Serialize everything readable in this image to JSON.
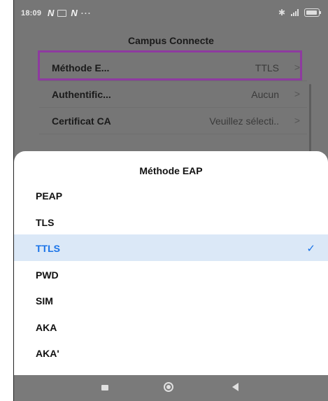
{
  "status": {
    "time": "18:09",
    "carrier_icons": [
      "n-logo-icon",
      "mail-icon",
      "n-logo-icon"
    ],
    "more": "···"
  },
  "background_screen": {
    "title": "Campus Connecte",
    "rows": [
      {
        "label": "Méthode E...",
        "value": "TTLS",
        "chevron": ">"
      },
      {
        "label": "Authentific...",
        "value": "Aucun",
        "chevron": ">"
      },
      {
        "label": "Certificat CA",
        "value": "Veuillez sélecti..",
        "chevron": ">"
      }
    ]
  },
  "sheet": {
    "title": "Méthode EAP",
    "options": [
      {
        "label": "PEAP",
        "selected": false
      },
      {
        "label": "TLS",
        "selected": false
      },
      {
        "label": "TTLS",
        "selected": true
      },
      {
        "label": "PWD",
        "selected": false
      },
      {
        "label": "SIM",
        "selected": false
      },
      {
        "label": "AKA",
        "selected": false
      },
      {
        "label": "AKA'",
        "selected": false
      }
    ],
    "check_glyph": "✓"
  },
  "colors": {
    "highlight": "#8e3aa0",
    "accent": "#1a73e8",
    "selected_bg": "#dbe8f7",
    "dim_background": "#767676"
  },
  "icons": {
    "nav_recent": "recent-apps-icon",
    "nav_home": "home-icon",
    "nav_back": "back-icon",
    "check": "checkmark-icon"
  }
}
